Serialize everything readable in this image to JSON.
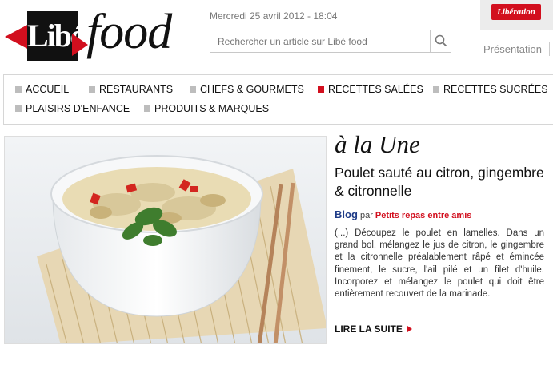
{
  "header": {
    "logo_libe": "Libé",
    "logo_food": "food",
    "date": "Mercredi 25 avril 2012 - 18:04",
    "search_placeholder": "Rechercher un article sur Libé food",
    "badge": "Libération",
    "presentation": "Présentation"
  },
  "nav": {
    "items": [
      {
        "label": "ACCUEIL",
        "active": false
      },
      {
        "label": "RESTAURANTS",
        "active": false
      },
      {
        "label": "CHEFS & GOURMETS",
        "active": false
      },
      {
        "label": "RECETTES SALÉES",
        "active": true
      },
      {
        "label": "RECETTES SUCRÉES",
        "active": false
      },
      {
        "label": "PLAISIRS D'ENFANCE",
        "active": false
      },
      {
        "label": "PRODUITS & MARQUES",
        "active": false
      }
    ]
  },
  "feature": {
    "section_title": "à la Une",
    "article_title": "Poulet sauté au citron, gingembre & citronnelle",
    "blog_label": "Blog",
    "by": "par",
    "author": "Petits repas entre amis",
    "excerpt": "(...) Découpez le poulet en lamelles. Dans un grand bol, mélangez le jus de citron, le gingembre et la citronnelle préalablement râpé et émincée finement, le sucre, l'ail pilé et un filet d'huile. Incorporez et mélangez le poulet qui doit être entièrement recouvert de la marinade.",
    "read_more": "LIRE LA SUITE"
  },
  "colors": {
    "accent_red": "#d20f1e",
    "blog_blue": "#1f3c88"
  }
}
